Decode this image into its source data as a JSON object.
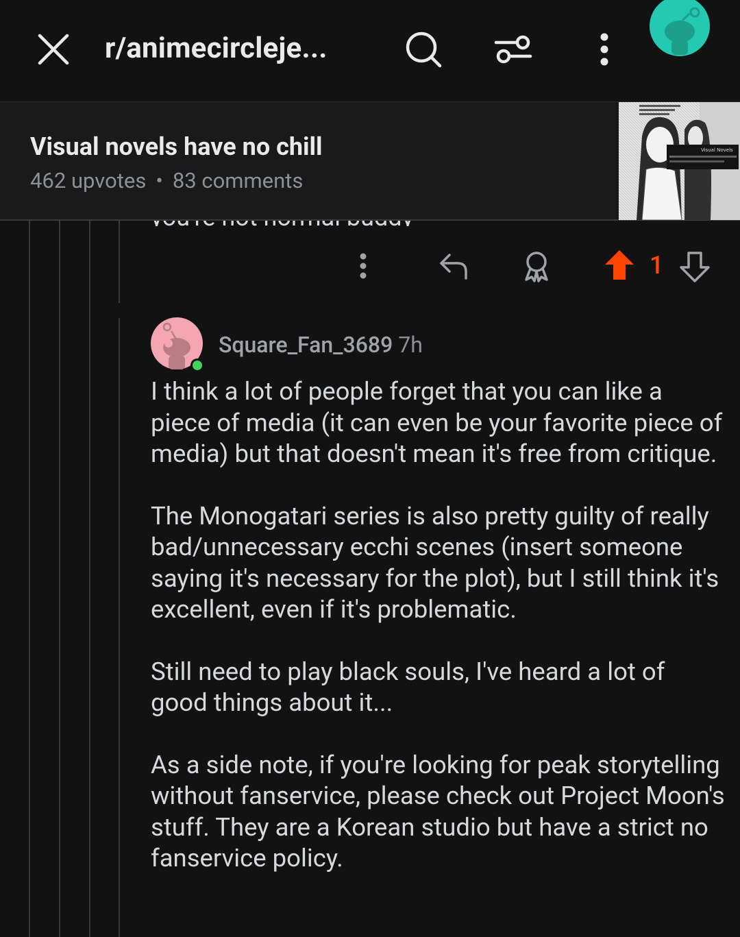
{
  "header": {
    "subreddit": "r/animecircleje..."
  },
  "post": {
    "title": "Visual novels have no chill",
    "upvotes": "462 upvotes",
    "separator": "•",
    "comments": "83 comments"
  },
  "previous_comment": {
    "cutoff_text": "you're not normal buddy",
    "vote_count": "1"
  },
  "comment": {
    "username": "Square_Fan_3689",
    "time": "7h",
    "paragraphs": [
      "I think a lot of people forget that you can like a piece of media (it can even be your favorite piece of media) but that doesn't mean it's free from critique.",
      "The Monogatari series is also pretty guilty of really bad/unnecessary ecchi scenes (insert someone saying it's necessary for the plot), but I still think it's excellent, even if it's problematic.",
      "Still need to play black souls, I've heard a lot of good things about it...",
      "As a side note, if you're looking for peak storytelling without fanservice, please check out Project Moon's stuff. They are a Korean studio but have a strict no fanservice policy."
    ]
  },
  "colors": {
    "background": "#121212",
    "header_bg": "#1a1a1b",
    "upvote_active": "#ff4500",
    "avatar_teal": "#24c9b1",
    "avatar_pink": "#f4a6b2",
    "online_dot": "#46d160"
  },
  "icons": {
    "close": "close-icon",
    "search": "search-icon",
    "filter": "sort-filter-icon",
    "more": "more-vertical-icon",
    "reply": "reply-icon",
    "award": "award-icon",
    "upvote": "upvote-icon",
    "downvote": "downvote-icon"
  }
}
